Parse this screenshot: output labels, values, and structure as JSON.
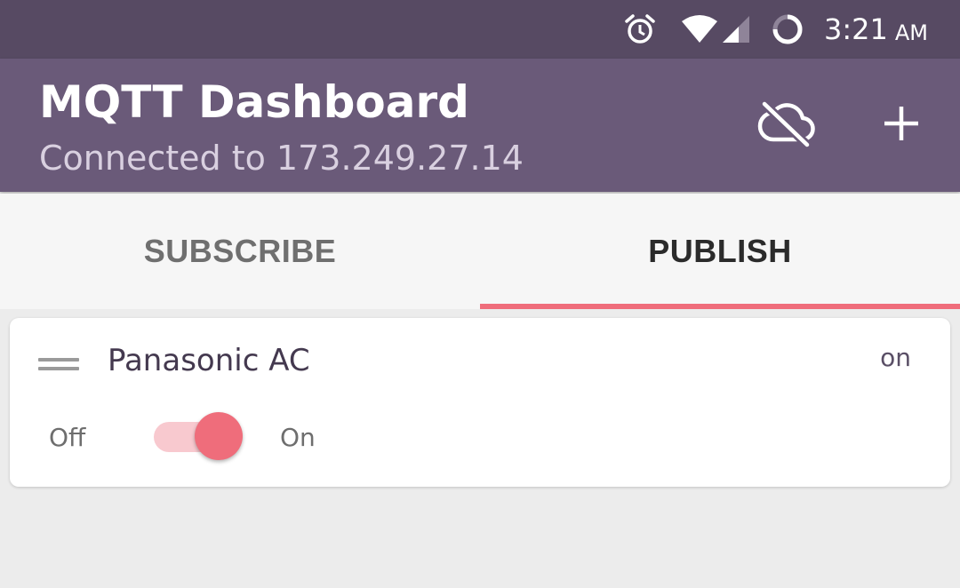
{
  "status_bar": {
    "icons": [
      "alarm-icon",
      "wifi-icon",
      "cell-signal-icon",
      "sync-icon"
    ],
    "time": "3:21",
    "ampm": "AM",
    "background": "#574a63"
  },
  "app_bar": {
    "title": "MQTT Dashboard",
    "subtitle": "Connected to 173.249.27.14",
    "actions": [
      "cloud-off-icon",
      "add-icon"
    ],
    "background": "#6a5a79"
  },
  "tabs": [
    {
      "label": "SUBSCRIBE",
      "active": false
    },
    {
      "label": "PUBLISH",
      "active": true
    }
  ],
  "accent": "#ef6d7b",
  "card": {
    "title": "Panasonic AC",
    "value": "on",
    "switch": {
      "off_label": "Off",
      "on_label": "On",
      "state": true
    }
  }
}
